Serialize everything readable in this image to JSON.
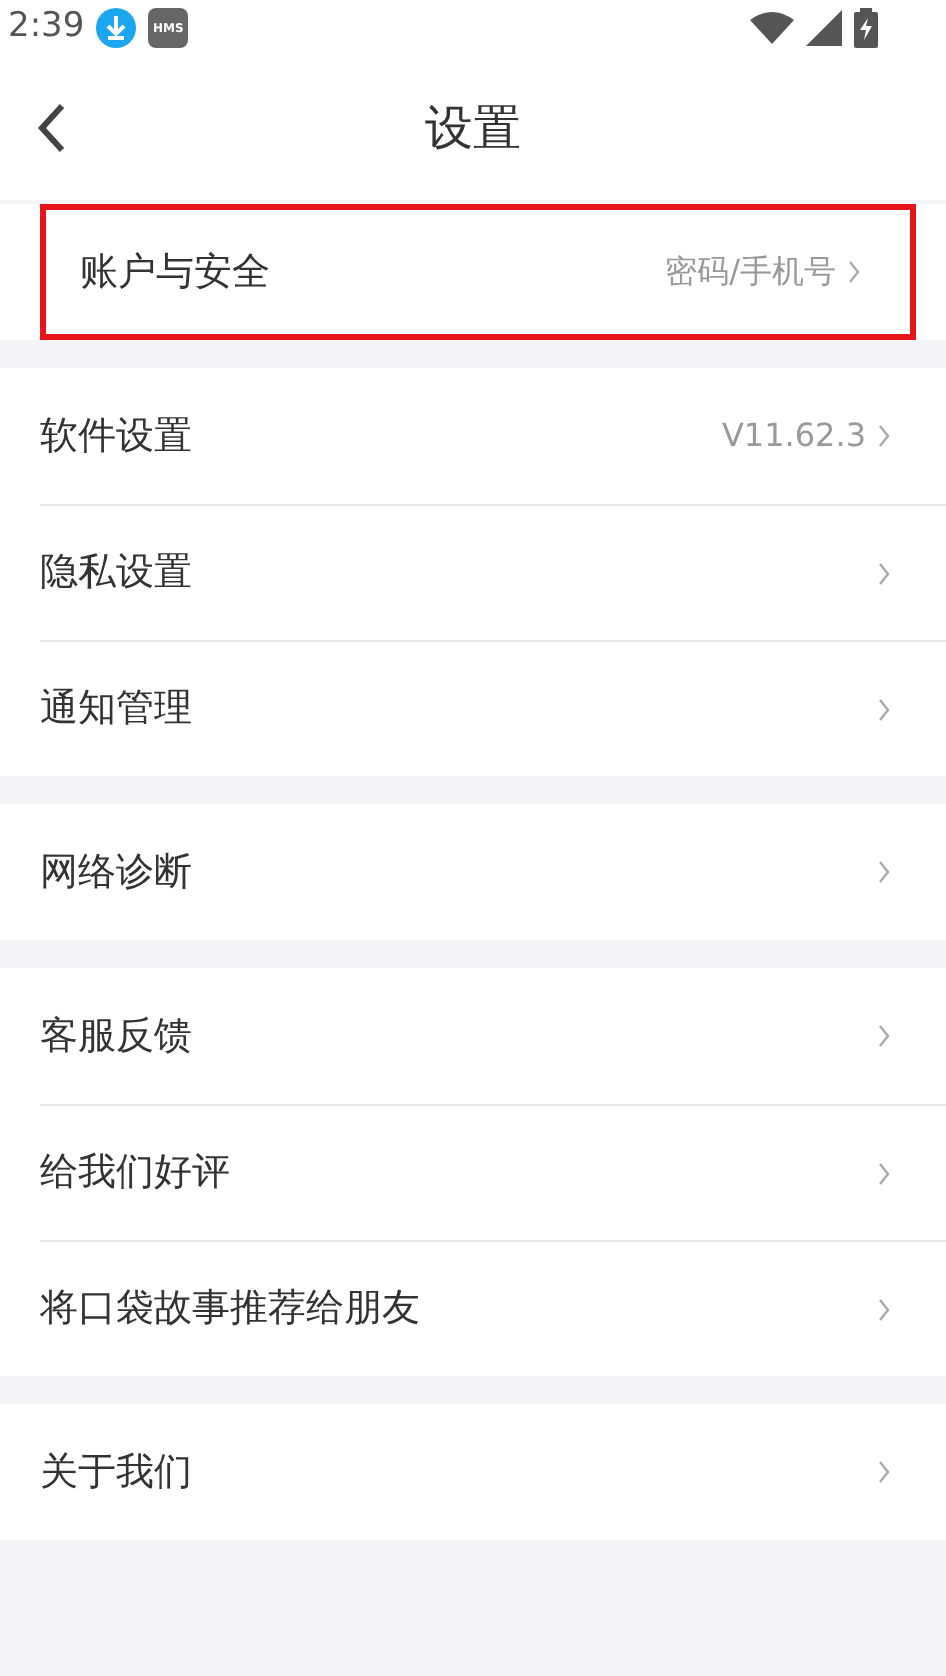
{
  "status_bar": {
    "time": "2:39",
    "badge": "HMS"
  },
  "header": {
    "title": "设置"
  },
  "groups": [
    {
      "items": [
        {
          "label": "账户与安全",
          "value": "密码/手机号",
          "highlighted": true
        }
      ]
    },
    {
      "items": [
        {
          "label": "软件设置",
          "value": "V11.62.3",
          "highlighted": false
        },
        {
          "label": "隐私设置",
          "highlighted": false
        },
        {
          "label": "通知管理",
          "highlighted": false
        }
      ]
    },
    {
      "items": [
        {
          "label": "网络诊断",
          "highlighted": false
        }
      ]
    },
    {
      "items": [
        {
          "label": "客服反馈",
          "highlighted": false
        },
        {
          "label": "给我们好评",
          "highlighted": false
        },
        {
          "label": "将口袋故事推荐给朋友",
          "highlighted": false
        }
      ]
    },
    {
      "items": [
        {
          "label": "关于我们",
          "highlighted": false
        }
      ]
    }
  ]
}
